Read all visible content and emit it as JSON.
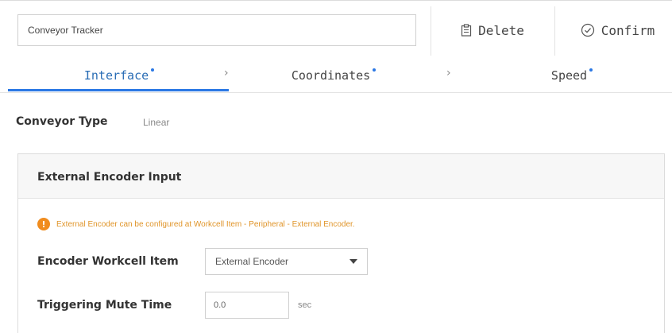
{
  "header": {
    "name_value": "Conveyor Tracker",
    "delete_label": "Delete",
    "confirm_label": "Confirm"
  },
  "tabs": [
    {
      "label": "Interface",
      "active": true
    },
    {
      "label": "Coordinates",
      "active": false
    },
    {
      "label": "Speed",
      "active": false
    }
  ],
  "tab_separator": "›",
  "conveyor_type": {
    "label": "Conveyor Type",
    "value": "Linear"
  },
  "encoder_panel": {
    "title": "External Encoder Input",
    "warning_icon": "!",
    "warning_text": "External Encoder can be configured at Workcell Item - Peripheral - External Encoder.",
    "workcell_item_label": "Encoder Workcell Item",
    "workcell_item_value": "External Encoder",
    "mute_time_label": "Triggering Mute Time",
    "mute_time_value": "0.0",
    "mute_time_unit": "sec"
  },
  "colors": {
    "accent": "#2b78e4",
    "warning": "#f08c1e"
  }
}
